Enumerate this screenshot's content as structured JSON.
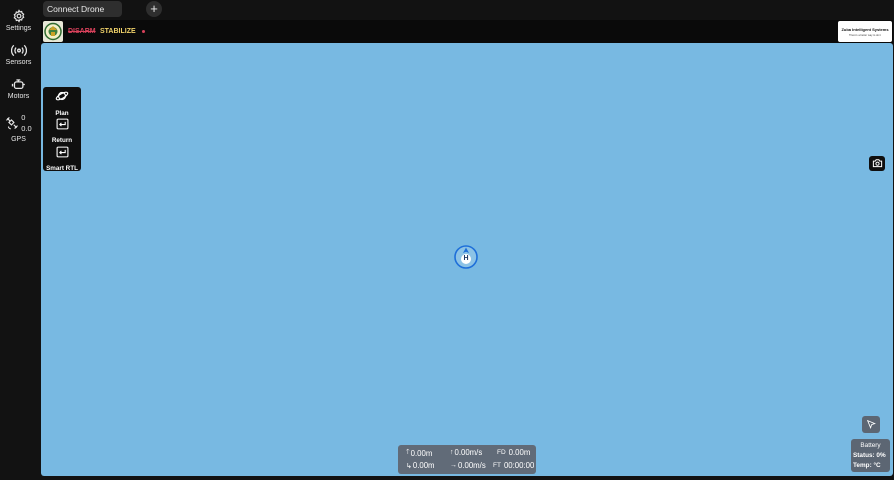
{
  "sidebar": {
    "items": [
      {
        "label": "Settings",
        "icon": "gear-icon"
      },
      {
        "label": "Sensors",
        "icon": "signal-icon"
      },
      {
        "label": "Motors",
        "icon": "motor-icon"
      },
      {
        "label": "GPS",
        "icon": "satellite-icon"
      }
    ],
    "gps_sats": "0",
    "gps_hdop": "0.0"
  },
  "tabs": [
    {
      "label": "Connect Drone"
    }
  ],
  "tab_add_label": "+",
  "status": {
    "arm_label": "DISARM",
    "mode_label": "STABILIZE",
    "brand_name": "Zuba Intelligent Systems",
    "brand_tagline": "There's a better way to do it"
  },
  "actions": [
    {
      "label": "Plan",
      "icon": "planet-icon"
    },
    {
      "label": "Return",
      "icon": "return-icon"
    },
    {
      "label": "Smart RTL",
      "icon": "return-icon"
    }
  ],
  "home_marker": {
    "label": "H"
  },
  "telemetry": {
    "altitude": "0.00m",
    "vertical_speed": "0.00m/s",
    "fd_label": "FD",
    "fd_value": "0.00m",
    "distance_home": "0.00m",
    "ground_speed": "0.00m/s",
    "ft_label": "FT",
    "flight_time": "00:00:00"
  },
  "battery": {
    "title": "Battery",
    "status": "Status: 0%",
    "temp": "Temp: °C"
  },
  "colors": {
    "map": "#78b9e2",
    "disarm": "#d9415b",
    "mode": "#f1d36a",
    "home_marker": "#1e6fd9",
    "panel": "#616b78"
  }
}
